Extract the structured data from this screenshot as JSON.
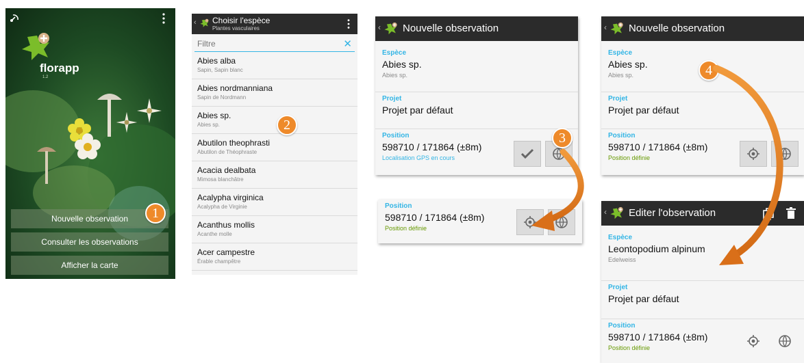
{
  "home": {
    "app_name": "florapp",
    "version": "1.2",
    "buttons": [
      "Nouvelle observation",
      "Consulter les observations",
      "Afficher la carte"
    ]
  },
  "species_list": {
    "title": "Choisir l'espèce",
    "subtitle": "Plantes vasculaires",
    "filter_placeholder": "Filtre",
    "items": [
      {
        "name": "Abies alba",
        "common": "Sapin, Sapin blanc"
      },
      {
        "name": "Abies nordmanniana",
        "common": "Sapin de Nordmann"
      },
      {
        "name": "Abies sp.",
        "common": "Abies sp."
      },
      {
        "name": "Abutilon theophrasti",
        "common": "Abutilon de Théophraste"
      },
      {
        "name": "Acacia dealbata",
        "common": "Mimosa blanchâtre"
      },
      {
        "name": "Acalypha virginica",
        "common": "Acalypha de Virginie"
      },
      {
        "name": "Acanthus mollis",
        "common": "Acanthe molle"
      },
      {
        "name": "Acer campestre",
        "common": "Érable champêtre"
      }
    ]
  },
  "obs1": {
    "title": "Nouvelle observation",
    "species_label": "Espèce",
    "species": "Abies sp.",
    "species_sub": "Abies sp.",
    "project_label": "Projet",
    "project": "Projet par défaut",
    "position_label": "Position",
    "position": "598710 / 171864 (±8m)",
    "position_status": "Localisation GPS en cours"
  },
  "obs_pos": {
    "position_label": "Position",
    "position": "598710 / 171864 (±8m)",
    "position_status": "Position définie"
  },
  "obs2": {
    "title": "Nouvelle observation",
    "species_label": "Espèce",
    "species": "Abies sp.",
    "species_sub": "Abies sp.",
    "project_label": "Projet",
    "project": "Projet par défaut",
    "position_label": "Position",
    "position": "598710 / 171864 (±8m)",
    "position_status": "Position définie"
  },
  "edit": {
    "title": "Editer l'observation",
    "species_label": "Espèce",
    "species": "Leontopodium alpinum",
    "species_sub": "Edelweiss",
    "project_label": "Projet",
    "project": "Projet par défaut",
    "position_label": "Position",
    "position": "598710 / 171864 (±8m)",
    "position_status": "Position définie"
  },
  "steps": [
    "1",
    "2",
    "3",
    "4"
  ],
  "colors": {
    "accent_blue": "#33b5e5",
    "status_green": "#669900",
    "step_orange": "#ee8a2a",
    "action_bar": "#2b2b2b"
  }
}
